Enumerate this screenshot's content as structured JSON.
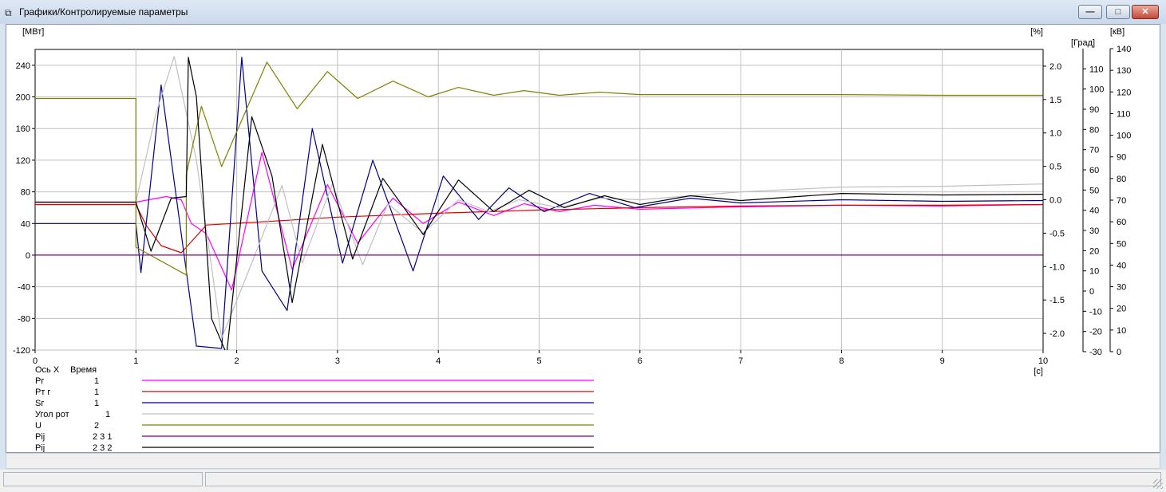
{
  "window": {
    "title": "Графики/Контролируемые параметры",
    "minimize_glyph": "—",
    "maximize_glyph": "□",
    "close_glyph": "✕",
    "icon": "chart-icon"
  },
  "axis_units": {
    "left": "[МВт]",
    "percent": "[%]",
    "grad": "[Град]",
    "kv": "[кВ]",
    "x": "[с]"
  },
  "legend": {
    "header_axis": "Ось X",
    "header_name": "Время",
    "items": [
      {
        "name": "Pг",
        "index": "1",
        "color": "#ff00ff"
      },
      {
        "name": "Pт г",
        "index": "1",
        "color": "#e00000"
      },
      {
        "name": "Sг",
        "index": "1",
        "color": "#000080"
      },
      {
        "name": "Угол рот",
        "index": "1",
        "color": "#c0c0c0"
      },
      {
        "name": "U",
        "index": "2",
        "color": "#808000"
      },
      {
        "name": "Pij",
        "index": "2  3  1",
        "color": "#800080"
      },
      {
        "name": "Pij",
        "index": "2  3  2",
        "color": "#000000"
      }
    ]
  },
  "chart_data": {
    "type": "line",
    "xlabel": "[с]",
    "ylabel": "[МВт]",
    "xlim": [
      0,
      10
    ],
    "ylim": [
      -120,
      260
    ],
    "x_ticks": [
      0,
      1,
      2,
      3,
      4,
      5,
      6,
      7,
      8,
      9,
      10
    ],
    "y_ticks": [
      240,
      200,
      160,
      120,
      80,
      40,
      0,
      -40,
      -80,
      -120
    ],
    "grid": true,
    "right_axes": [
      {
        "unit": "[%]",
        "ticks": [
          2.0,
          1.5,
          1.0,
          0.5,
          0.0,
          -0.5,
          -1.0,
          -1.5,
          -2.0
        ],
        "range": [
          -2.25,
          2.25
        ]
      },
      {
        "unit": "[Град]",
        "ticks": [
          110,
          100,
          90,
          80,
          70,
          60,
          50,
          40,
          30,
          20,
          10,
          0,
          -10,
          -20,
          -30
        ],
        "range": [
          -30,
          120
        ]
      },
      {
        "unit": "[кВ]",
        "ticks": [
          140,
          130,
          120,
          110,
          100,
          90,
          80,
          70,
          60,
          50,
          40,
          30,
          20,
          10,
          0
        ],
        "range": [
          0,
          140
        ]
      }
    ],
    "series": [
      {
        "name": "Pг 1",
        "color": "#ff00ff",
        "points": [
          [
            0,
            67
          ],
          [
            1,
            67
          ],
          [
            1.3,
            74
          ],
          [
            1.45,
            70
          ],
          [
            1.55,
            40
          ],
          [
            1.7,
            27
          ],
          [
            1.95,
            -44
          ],
          [
            2.25,
            130
          ],
          [
            2.55,
            -18
          ],
          [
            2.9,
            89
          ],
          [
            3.2,
            15
          ],
          [
            3.55,
            72
          ],
          [
            3.85,
            40
          ],
          [
            4.2,
            67
          ],
          [
            4.55,
            50
          ],
          [
            4.85,
            65
          ],
          [
            5.2,
            55
          ],
          [
            5.55,
            63
          ],
          [
            6,
            58
          ],
          [
            7,
            61
          ],
          [
            8,
            63
          ],
          [
            9,
            62
          ],
          [
            10,
            64
          ]
        ]
      },
      {
        "name": "Pт г 1",
        "color": "#e00000",
        "points": [
          [
            0,
            64
          ],
          [
            1,
            64
          ],
          [
            1.1,
            38
          ],
          [
            1.25,
            12
          ],
          [
            1.45,
            3
          ],
          [
            1.7,
            38
          ],
          [
            2.5,
            44
          ],
          [
            3,
            48
          ],
          [
            4,
            53
          ],
          [
            5,
            57
          ],
          [
            6,
            60
          ],
          [
            7,
            62
          ],
          [
            8,
            63
          ],
          [
            9,
            63
          ],
          [
            10,
            64
          ]
        ]
      },
      {
        "name": "Sг 1",
        "color": "#000080",
        "points": [
          [
            0,
            40
          ],
          [
            1,
            40
          ],
          [
            1.05,
            -22
          ],
          [
            1.25,
            215
          ],
          [
            1.5,
            -20
          ],
          [
            1.6,
            -115
          ],
          [
            1.85,
            -118
          ],
          [
            2.05,
            250
          ],
          [
            2.25,
            -20
          ],
          [
            2.5,
            -70
          ],
          [
            2.75,
            160
          ],
          [
            3.05,
            -10
          ],
          [
            3.35,
            120
          ],
          [
            3.75,
            -20
          ],
          [
            4.05,
            100
          ],
          [
            4.4,
            45
          ],
          [
            4.7,
            85
          ],
          [
            5.05,
            55
          ],
          [
            5.5,
            78
          ],
          [
            5.95,
            60
          ],
          [
            6.5,
            72
          ],
          [
            7,
            66
          ],
          [
            8,
            70
          ],
          [
            9,
            68
          ],
          [
            10,
            69
          ]
        ]
      },
      {
        "name": "Угол рот 1",
        "color": "#c0c0c0",
        "points": [
          [
            0,
            67
          ],
          [
            1,
            67
          ],
          [
            1.2,
            180
          ],
          [
            1.38,
            251
          ],
          [
            1.6,
            120
          ],
          [
            1.85,
            -105
          ],
          [
            2.15,
            -10
          ],
          [
            2.45,
            88
          ],
          [
            2.65,
            -10
          ],
          [
            2.95,
            90
          ],
          [
            3.25,
            -12
          ],
          [
            3.5,
            65
          ],
          [
            3.85,
            28
          ],
          [
            4.2,
            70
          ],
          [
            4.5,
            55
          ],
          [
            4.8,
            70
          ],
          [
            5.2,
            60
          ],
          [
            5.6,
            72
          ],
          [
            6,
            70
          ],
          [
            7,
            80
          ],
          [
            8,
            86
          ],
          [
            9,
            87
          ],
          [
            10,
            90
          ]
        ]
      },
      {
        "name": "U 2",
        "color": "#808000",
        "points": [
          [
            0,
            198
          ],
          [
            1,
            198
          ],
          [
            1,
            10
          ],
          [
            1.5,
            -25
          ],
          [
            1.5,
            102
          ],
          [
            1.65,
            188
          ],
          [
            1.85,
            112
          ],
          [
            2.3,
            244
          ],
          [
            2.6,
            185
          ],
          [
            2.9,
            232
          ],
          [
            3.2,
            198
          ],
          [
            3.55,
            220
          ],
          [
            3.9,
            200
          ],
          [
            4.2,
            212
          ],
          [
            4.55,
            202
          ],
          [
            4.85,
            208
          ],
          [
            5.2,
            202
          ],
          [
            5.6,
            206
          ],
          [
            6,
            203
          ],
          [
            7,
            203
          ],
          [
            8,
            203
          ],
          [
            9,
            202
          ],
          [
            10,
            202
          ]
        ]
      },
      {
        "name": "Pij 2 3 1",
        "color": "#800080",
        "points": [
          [
            0,
            0
          ],
          [
            10,
            0
          ]
        ]
      },
      {
        "name": "Pij 2 3 2",
        "color": "#000000",
        "points": [
          [
            0,
            67
          ],
          [
            1,
            67
          ],
          [
            1.15,
            5
          ],
          [
            1.35,
            72
          ],
          [
            1.5,
            74
          ],
          [
            1.52,
            250
          ],
          [
            1.6,
            200
          ],
          [
            1.75,
            -80
          ],
          [
            1.9,
            -125
          ],
          [
            2.15,
            175
          ],
          [
            2.35,
            100
          ],
          [
            2.55,
            -60
          ],
          [
            2.85,
            140
          ],
          [
            3.15,
            -5
          ],
          [
            3.45,
            97
          ],
          [
            3.85,
            26
          ],
          [
            4.2,
            95
          ],
          [
            4.55,
            55
          ],
          [
            4.9,
            82
          ],
          [
            5.25,
            60
          ],
          [
            5.65,
            75
          ],
          [
            6,
            64
          ],
          [
            6.5,
            75
          ],
          [
            7,
            69
          ],
          [
            8,
            78
          ],
          [
            9,
            76
          ],
          [
            10,
            77
          ]
        ]
      }
    ]
  }
}
